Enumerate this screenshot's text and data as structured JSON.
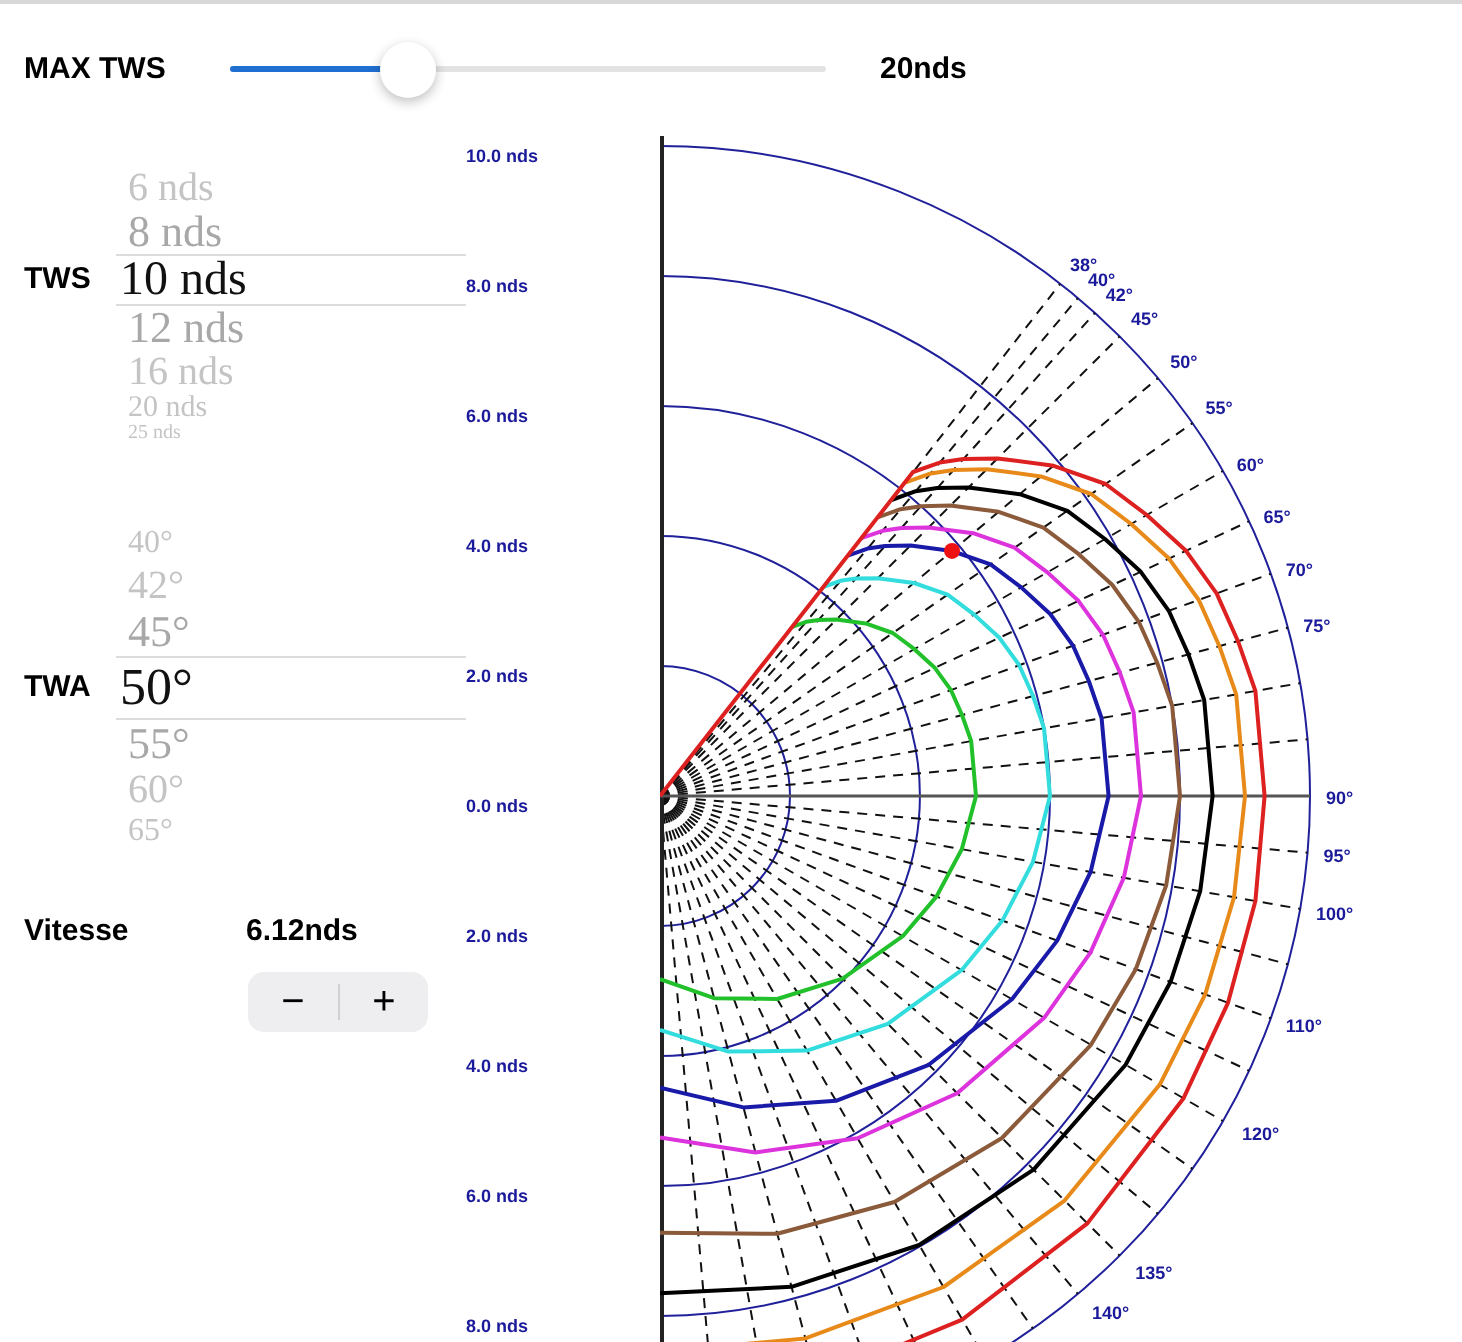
{
  "slider": {
    "label": "MAX TWS",
    "level": 0.3,
    "value": "20nds"
  },
  "tws": {
    "label": "TWS",
    "items": [
      {
        "text": "6 nds",
        "selected": false
      },
      {
        "text": "8 nds",
        "selected": false
      },
      {
        "text": "10 nds",
        "selected": true
      },
      {
        "text": "12 nds",
        "selected": false
      },
      {
        "text": "16 nds",
        "selected": false
      },
      {
        "text": "20 nds",
        "selected": false
      },
      {
        "text": "25 nds",
        "selected": false
      }
    ]
  },
  "twa": {
    "label": "TWA",
    "items": [
      {
        "text": "40°",
        "selected": false
      },
      {
        "text": "42°",
        "selected": false
      },
      {
        "text": "45°",
        "selected": false
      },
      {
        "text": "50°",
        "selected": true
      },
      {
        "text": "55°",
        "selected": false
      },
      {
        "text": "60°",
        "selected": false
      },
      {
        "text": "65°",
        "selected": false
      }
    ]
  },
  "speed": {
    "label": "Vitesse",
    "value": "6.12nds",
    "decrement": "−",
    "increment": "+"
  },
  "polar": {
    "speed_labels": [
      "10.0 nds",
      "8.0 nds",
      "6.0 nds",
      "4.0 nds",
      "2.0 nds",
      "0.0 nds",
      "2.0 nds",
      "4.0 nds",
      "6.0 nds",
      "8.0 nds"
    ],
    "angle_labels": [
      "38°",
      "40°",
      "42°",
      "45°",
      "50°",
      "55°",
      "60°",
      "65°",
      "70°",
      "75°",
      "90°",
      "95°",
      "100°",
      "110°",
      "120°",
      "135°",
      "140°"
    ]
  }
}
